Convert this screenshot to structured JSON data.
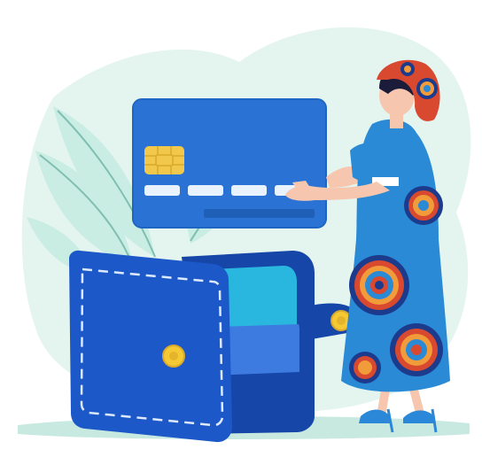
{
  "illustration": {
    "subject": "woman-handing-credit-card-to-open-wallet",
    "icons": [
      "credit-card-icon",
      "card-chip-icon",
      "wallet-icon",
      "wallet-button-icon",
      "woman-figure-icon",
      "leaf-plant-icon"
    ],
    "colors": {
      "background_blob": "#e4f5f0",
      "leaves": "#c9ece3",
      "leaf_stems": "#7fbfb0",
      "ground": "#c8e9e0",
      "card_blue": "#2a73d4",
      "card_stripe": "#1f5fb8",
      "chip_gold": "#f1c84b",
      "wallet_blue": "#1d58c8",
      "wallet_dark": "#1647a8",
      "wallet_inner": "#2ab7df",
      "wallet_pocket": "#3e7be0",
      "button_gold": "#f4c934",
      "dress_blue": "#2a8ad6",
      "pattern_red": "#d8492f",
      "pattern_orange": "#f29b3b",
      "pattern_navy": "#1c3b8c",
      "skin": "#f7c6ae",
      "hair": "#1b1b3a",
      "shoes": "#2b88d8"
    }
  }
}
